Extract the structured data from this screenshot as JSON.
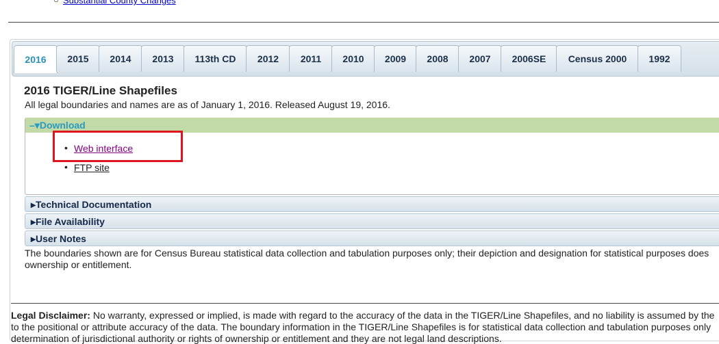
{
  "top_link": "Substantial County Changes",
  "tabs": [
    "2016",
    "2015",
    "2014",
    "2013",
    "113th CD",
    "2012",
    "2011",
    "2010",
    "2009",
    "2008",
    "2007",
    "2006SE",
    "Census 2000",
    "1992"
  ],
  "heading": "2016 TIGER/Line Shapefiles",
  "subtitle": "All legal boundaries and names are as of January 1, 2016. Released August 19, 2016.",
  "download": {
    "label": "Download",
    "links": [
      "Web interface",
      "FTP site"
    ]
  },
  "sections": [
    "Technical Documentation",
    "File Availability",
    "User Notes"
  ],
  "note": [
    "The boundaries shown are for Census Bureau statistical data collection and tabulation purposes only; their depiction and designation for statistical purposes does",
    "ownership or entitlement."
  ],
  "disclaimer": {
    "label": "Legal Disclaimer:",
    "lines": [
      "No warranty, expressed or implied, is made with regard to the accuracy of the data in the TIGER/Line Shapefiles, and no liability is assumed by the",
      "to the positional or attribute accuracy of the data. The boundary information in the TIGER/Line Shapefiles is for statistical data collection and tabulation purposes only",
      "determination of jurisdictional authority or rights of ownership or entitlement and they are not legal land descriptions."
    ]
  },
  "colors": {
    "highlight": "#e0141e",
    "download_bar": "#c2d9a8",
    "active_tab": "#2a8fbd"
  }
}
